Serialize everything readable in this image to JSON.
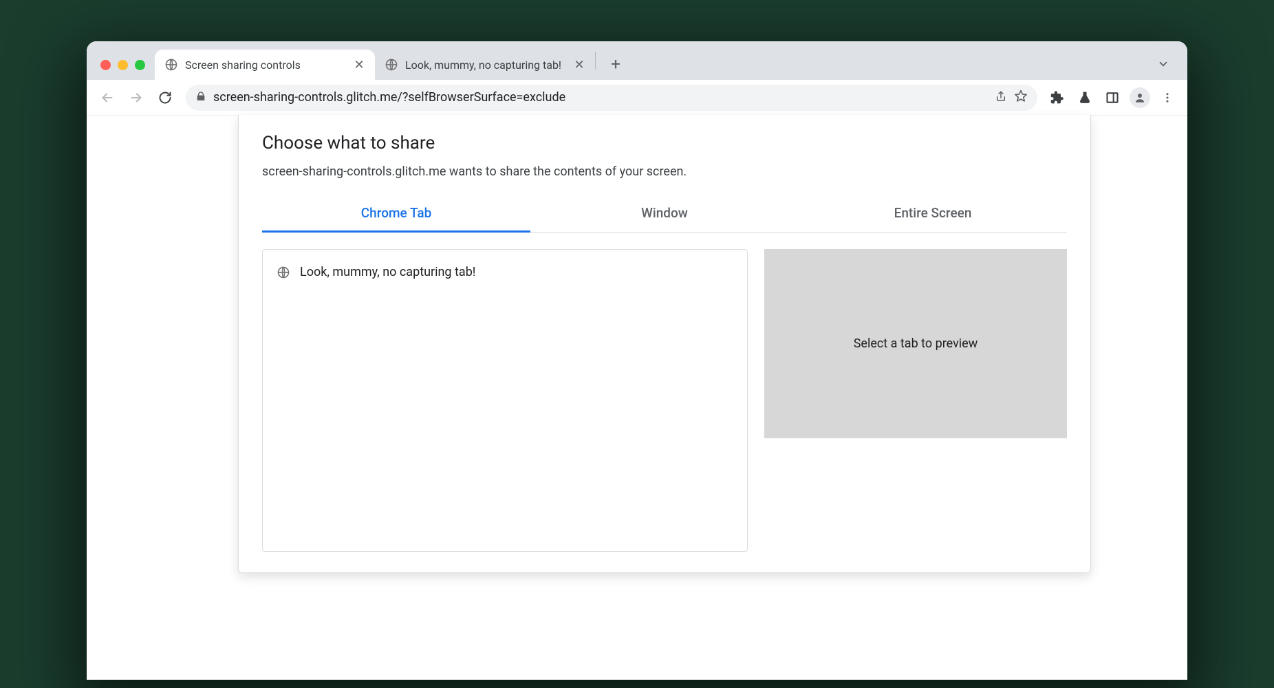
{
  "browser": {
    "tabs": [
      {
        "title": "Screen sharing controls",
        "active": true
      },
      {
        "title": "Look, mummy, no capturing tab!",
        "active": false
      }
    ],
    "url": "screen-sharing-controls.glitch.me/?selfBrowserSurface=exclude"
  },
  "picker": {
    "title": "Choose what to share",
    "subtitle": "screen-sharing-controls.glitch.me wants to share the contents of your screen.",
    "tabs": {
      "chrome_tab": "Chrome Tab",
      "window": "Window",
      "entire_screen": "Entire Screen"
    },
    "list": [
      {
        "title": "Look, mummy, no capturing tab!"
      }
    ],
    "preview_placeholder": "Select a tab to preview"
  }
}
